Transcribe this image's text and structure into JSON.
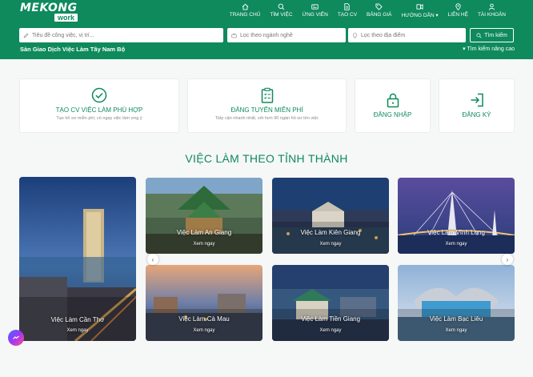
{
  "brand": {
    "logo_top": "MEKONG",
    "logo_bottom": "work"
  },
  "nav": {
    "items": [
      {
        "label": "TRANG CHỦ",
        "icon": "home-icon"
      },
      {
        "label": "TÌM VIỆC",
        "icon": "search-icon"
      },
      {
        "label": "ỨNG VIÊN",
        "icon": "id-card-icon"
      },
      {
        "label": "TẠO CV",
        "icon": "document-icon"
      },
      {
        "label": "BẢNG GIÁ",
        "icon": "tag-icon"
      },
      {
        "label": "HƯỚNG DẪN",
        "icon": "guide-icon"
      },
      {
        "label": "LIÊN HỆ",
        "icon": "location-pin-icon"
      },
      {
        "label": "TÀI KHOẢN",
        "icon": "user-icon"
      }
    ]
  },
  "search": {
    "keyword_placeholder": "Tiêu đề công việc, vị trí...",
    "industry_placeholder": "Lọc theo ngành nghề",
    "location_placeholder": "Lọc theo địa điểm",
    "button_label": "Tìm kiếm",
    "subtitle": "Sàn Giao Dịch Việc Làm Tây Nam Bộ",
    "advanced_label": "Tìm kiếm nâng cao"
  },
  "features": {
    "create_cv": {
      "title": "TẠO CV VIỆC LÀM PHÙ HỢP",
      "desc": "Tạo hồ sơ miễn phí, có ngay việc làm ưng ý"
    },
    "post_job": {
      "title": "ĐĂNG TUYỂN MIỄN PHÍ",
      "desc": "Tiếp cận nhanh nhất, với hơn 90 ngàn hồ sơ tìm việc"
    },
    "login": {
      "title": "ĐĂNG NHẬP"
    },
    "register": {
      "title": "ĐĂNG KÝ"
    }
  },
  "section_title": "VIỆC LÀM THEO TỈNH THÀNH",
  "provinces": {
    "can_tho": {
      "name": "Việc Làm Cần Thơ",
      "link": "Xem ngay"
    },
    "an_giang": {
      "name": "Việc Làm An Giang",
      "link": "Xem ngay"
    },
    "kien_giang": {
      "name": "Việc Làm Kiên Giang",
      "link": "Xem ngay"
    },
    "vinh_long": {
      "name": "Việc Làm Vĩnh Long",
      "link": "Xem ngay"
    },
    "ca_mau": {
      "name": "Việc Làm Cà Mau",
      "link": "Xem ngay"
    },
    "tien_giang": {
      "name": "Việc Làm Tiền Giang",
      "link": "Xem ngay"
    },
    "bac_lieu": {
      "name": "Việc Làm Bạc Liêu",
      "link": "Xem ngay"
    }
  },
  "colors": {
    "brand_green": "#0e8a5c",
    "header_bg": "#0e8a5c",
    "page_bg": "#f6f7f7"
  }
}
